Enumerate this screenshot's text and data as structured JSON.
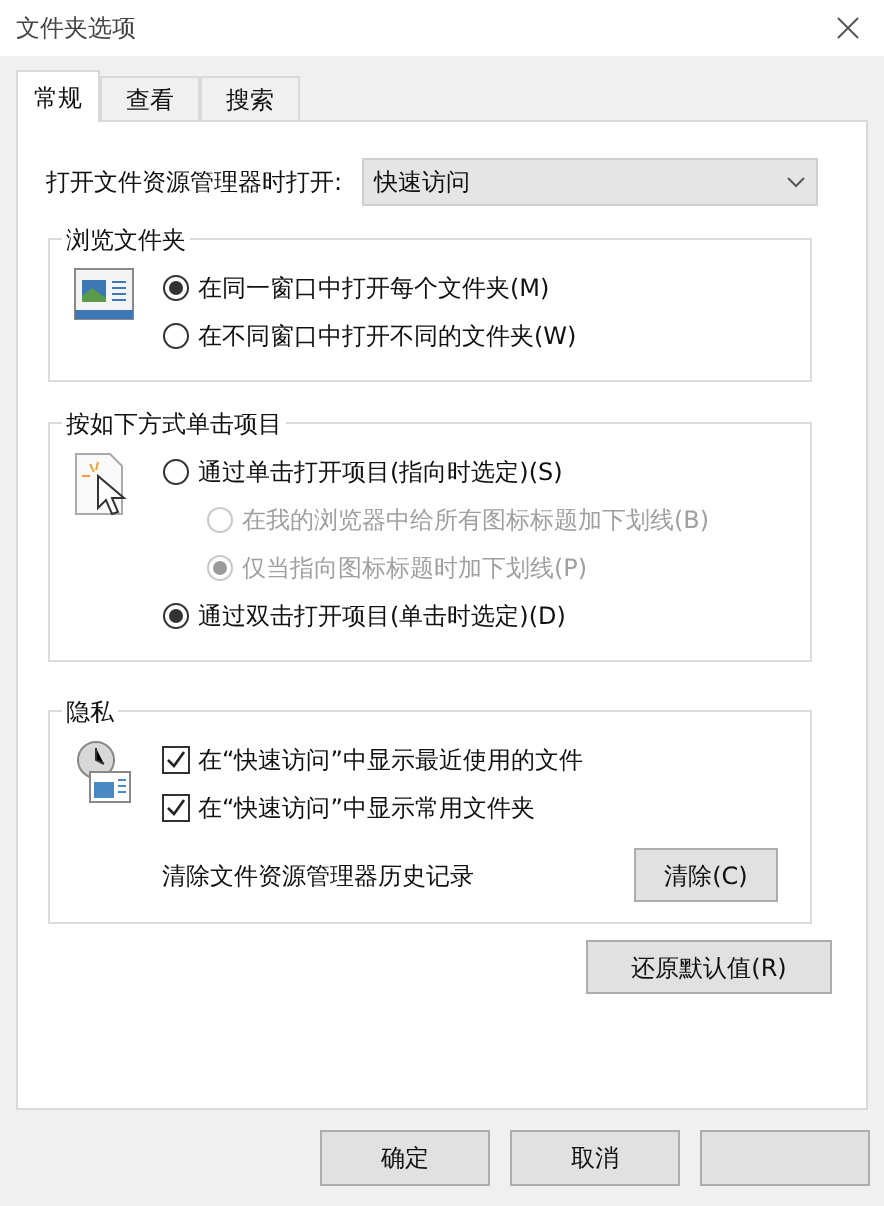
{
  "window": {
    "title": "文件夹选项"
  },
  "tabs": [
    {
      "label": "常规",
      "selected": true
    },
    {
      "label": "查看",
      "selected": false
    },
    {
      "label": "搜索",
      "selected": false
    }
  ],
  "startup": {
    "label": "打开文件资源管理器时打开:",
    "value": "快速访问"
  },
  "browse_folders": {
    "title": "浏览文件夹",
    "options": [
      {
        "label": "在同一窗口中打开每个文件夹(M)",
        "selected": true,
        "disabled": false,
        "indent": false
      },
      {
        "label": "在不同窗口中打开不同的文件夹(W)",
        "selected": false,
        "disabled": false,
        "indent": false
      }
    ]
  },
  "click_items": {
    "title": "按如下方式单击项目",
    "options": [
      {
        "label": "通过单击打开项目(指向时选定)(S)",
        "selected": false,
        "disabled": false,
        "indent": false
      },
      {
        "label": "在我的浏览器中给所有图标标题加下划线(B)",
        "selected": false,
        "disabled": true,
        "indent": true
      },
      {
        "label": "仅当指向图标标题时加下划线(P)",
        "selected": true,
        "disabled": true,
        "indent": true
      },
      {
        "label": "通过双击打开项目(单击时选定)(D)",
        "selected": true,
        "disabled": false,
        "indent": false
      }
    ]
  },
  "privacy": {
    "title": "隐私",
    "checkboxes": [
      {
        "label": "在“快速访问”中显示最近使用的文件",
        "checked": true
      },
      {
        "label": "在“快速访问”中显示常用文件夹",
        "checked": true
      }
    ],
    "clear_label": "清除文件资源管理器历史记录",
    "clear_button": "清除(C)"
  },
  "restore_button": "还原默认值(R)",
  "buttons": [
    {
      "label": "确定"
    },
    {
      "label": "取消"
    }
  ]
}
